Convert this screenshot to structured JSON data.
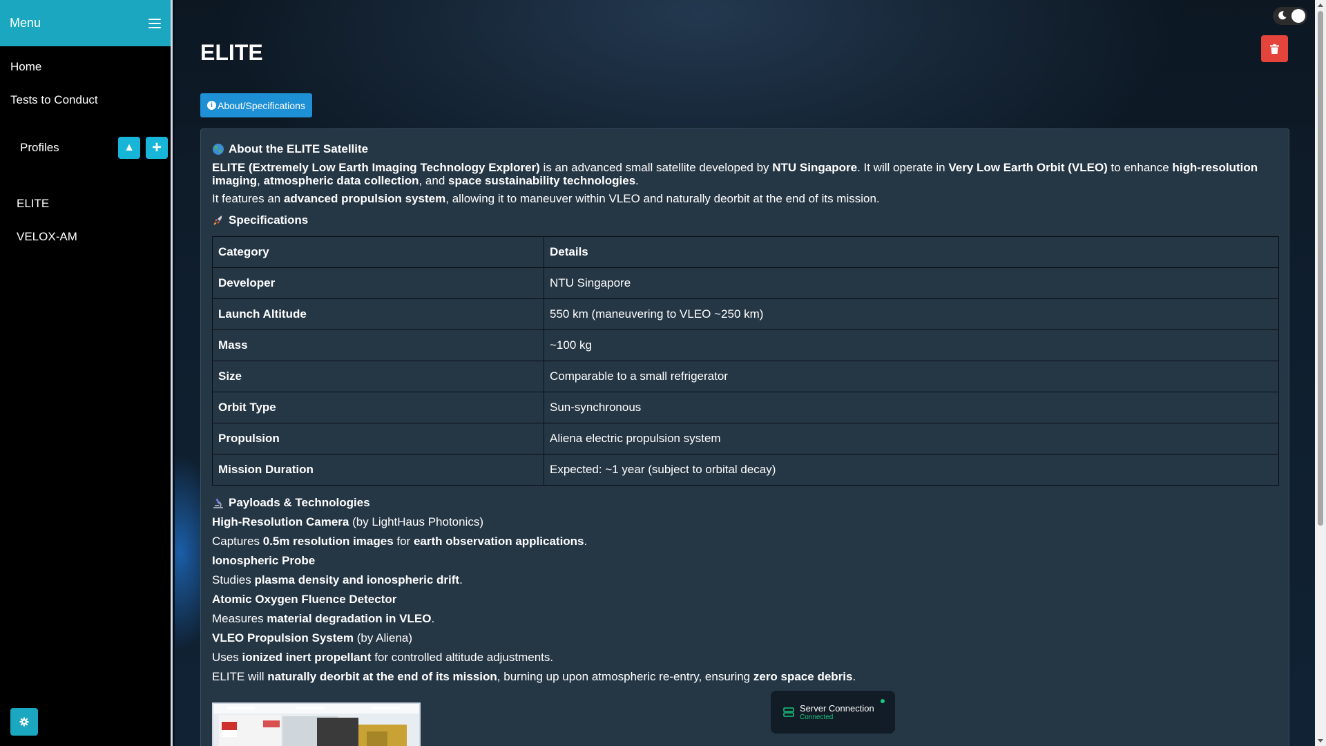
{
  "sidebar": {
    "menu_title": "Menu",
    "nav": [
      {
        "label": "Home"
      },
      {
        "label": "Tests to Conduct"
      }
    ],
    "profiles_label": "Profiles",
    "collapse_glyph": "▲",
    "add_glyph": "+",
    "profiles": [
      {
        "label": "ELITE"
      },
      {
        "label": "VELOX-AM"
      }
    ]
  },
  "header": {
    "title": "ELITE",
    "tab_label": "About/Specifications",
    "info_glyph": "i"
  },
  "about": {
    "heading": "About the ELITE Satellite",
    "p1": [
      {
        "t": "ELITE (Extremely Low Earth Imaging Technology Explorer)",
        "b": true
      },
      {
        "t": " is an advanced small satellite developed by ",
        "b": false
      },
      {
        "t": "NTU Singapore",
        "b": true
      },
      {
        "t": ". It will operate in ",
        "b": false
      },
      {
        "t": "Very Low Earth Orbit (VLEO)",
        "b": true
      },
      {
        "t": " to enhance ",
        "b": false
      },
      {
        "t": "high-resolution imaging",
        "b": true
      },
      {
        "t": ", ",
        "b": false
      },
      {
        "t": "atmospheric data collection",
        "b": true
      },
      {
        "t": ", and ",
        "b": false
      },
      {
        "t": "space sustainability technologies",
        "b": true
      },
      {
        "t": ".",
        "b": false
      }
    ],
    "p2": [
      {
        "t": "It features an ",
        "b": false
      },
      {
        "t": "advanced propulsion system",
        "b": true
      },
      {
        "t": ", allowing it to maneuver within VLEO and naturally deorbit at the end of its mission.",
        "b": false
      }
    ]
  },
  "specs": {
    "heading": "Specifications",
    "columns": [
      "Category",
      "Details"
    ],
    "rows": [
      {
        "category": "Developer",
        "details": "NTU Singapore"
      },
      {
        "category": "Launch Altitude",
        "details": "550 km (maneuvering to VLEO ~250 km)"
      },
      {
        "category": "Mass",
        "details": "~100 kg"
      },
      {
        "category": "Size",
        "details": "Comparable to a small refrigerator"
      },
      {
        "category": "Orbit Type",
        "details": "Sun-synchronous"
      },
      {
        "category": "Propulsion",
        "details": "Aliena electric propulsion system"
      },
      {
        "category": "Mission Duration",
        "details": "Expected: ~1 year (subject to orbital decay)"
      }
    ]
  },
  "payloads": {
    "heading": "Payloads & Technologies",
    "lines": [
      [
        {
          "t": "High-Resolution Camera",
          "b": true
        },
        {
          "t": " (by LightHaus Photonics)",
          "b": false
        }
      ],
      [
        {
          "t": "Captures ",
          "b": false
        },
        {
          "t": "0.5m resolution images",
          "b": true
        },
        {
          "t": " for ",
          "b": false
        },
        {
          "t": "earth observation applications",
          "b": true
        },
        {
          "t": ".",
          "b": false
        }
      ],
      [
        {
          "t": "Ionospheric Probe",
          "b": true
        }
      ],
      [
        {
          "t": "Studies ",
          "b": false
        },
        {
          "t": "plasma density and ionospheric drift",
          "b": true
        },
        {
          "t": ".",
          "b": false
        }
      ],
      [
        {
          "t": "Atomic Oxygen Fluence Detector",
          "b": true
        }
      ],
      [
        {
          "t": "Measures ",
          "b": false
        },
        {
          "t": "material degradation in VLEO",
          "b": true
        },
        {
          "t": ".",
          "b": false
        }
      ],
      [
        {
          "t": "VLEO Propulsion System",
          "b": true
        },
        {
          "t": " (by Aliena)",
          "b": false
        }
      ],
      [
        {
          "t": "Uses ",
          "b": false
        },
        {
          "t": "ionized inert propellant",
          "b": true
        },
        {
          "t": " for controlled altitude adjustments.",
          "b": false
        }
      ],
      [
        {
          "t": "ELITE will ",
          "b": false
        },
        {
          "t": "naturally deorbit at the end of its mission",
          "b": true
        },
        {
          "t": ", burning up upon atmospheric re-entry, ensuring ",
          "b": false
        },
        {
          "t": "zero space debris",
          "b": true
        },
        {
          "t": ".",
          "b": false
        }
      ]
    ]
  },
  "server": {
    "label": "Server Connection",
    "status": "Connected"
  },
  "icons": {
    "menu": "hamburger-icon",
    "settings": "gear-icon",
    "theme": "moon-icon",
    "delete": "trash-icon",
    "about": "globe-icon",
    "specs": "rocket-icon",
    "payloads": "microscope-icon",
    "server": "server-icon"
  },
  "colors": {
    "accent": "#1aa7bf",
    "tab": "#1e90d6",
    "danger": "#e4443b",
    "card": "#253645",
    "connected": "#18c77e"
  }
}
